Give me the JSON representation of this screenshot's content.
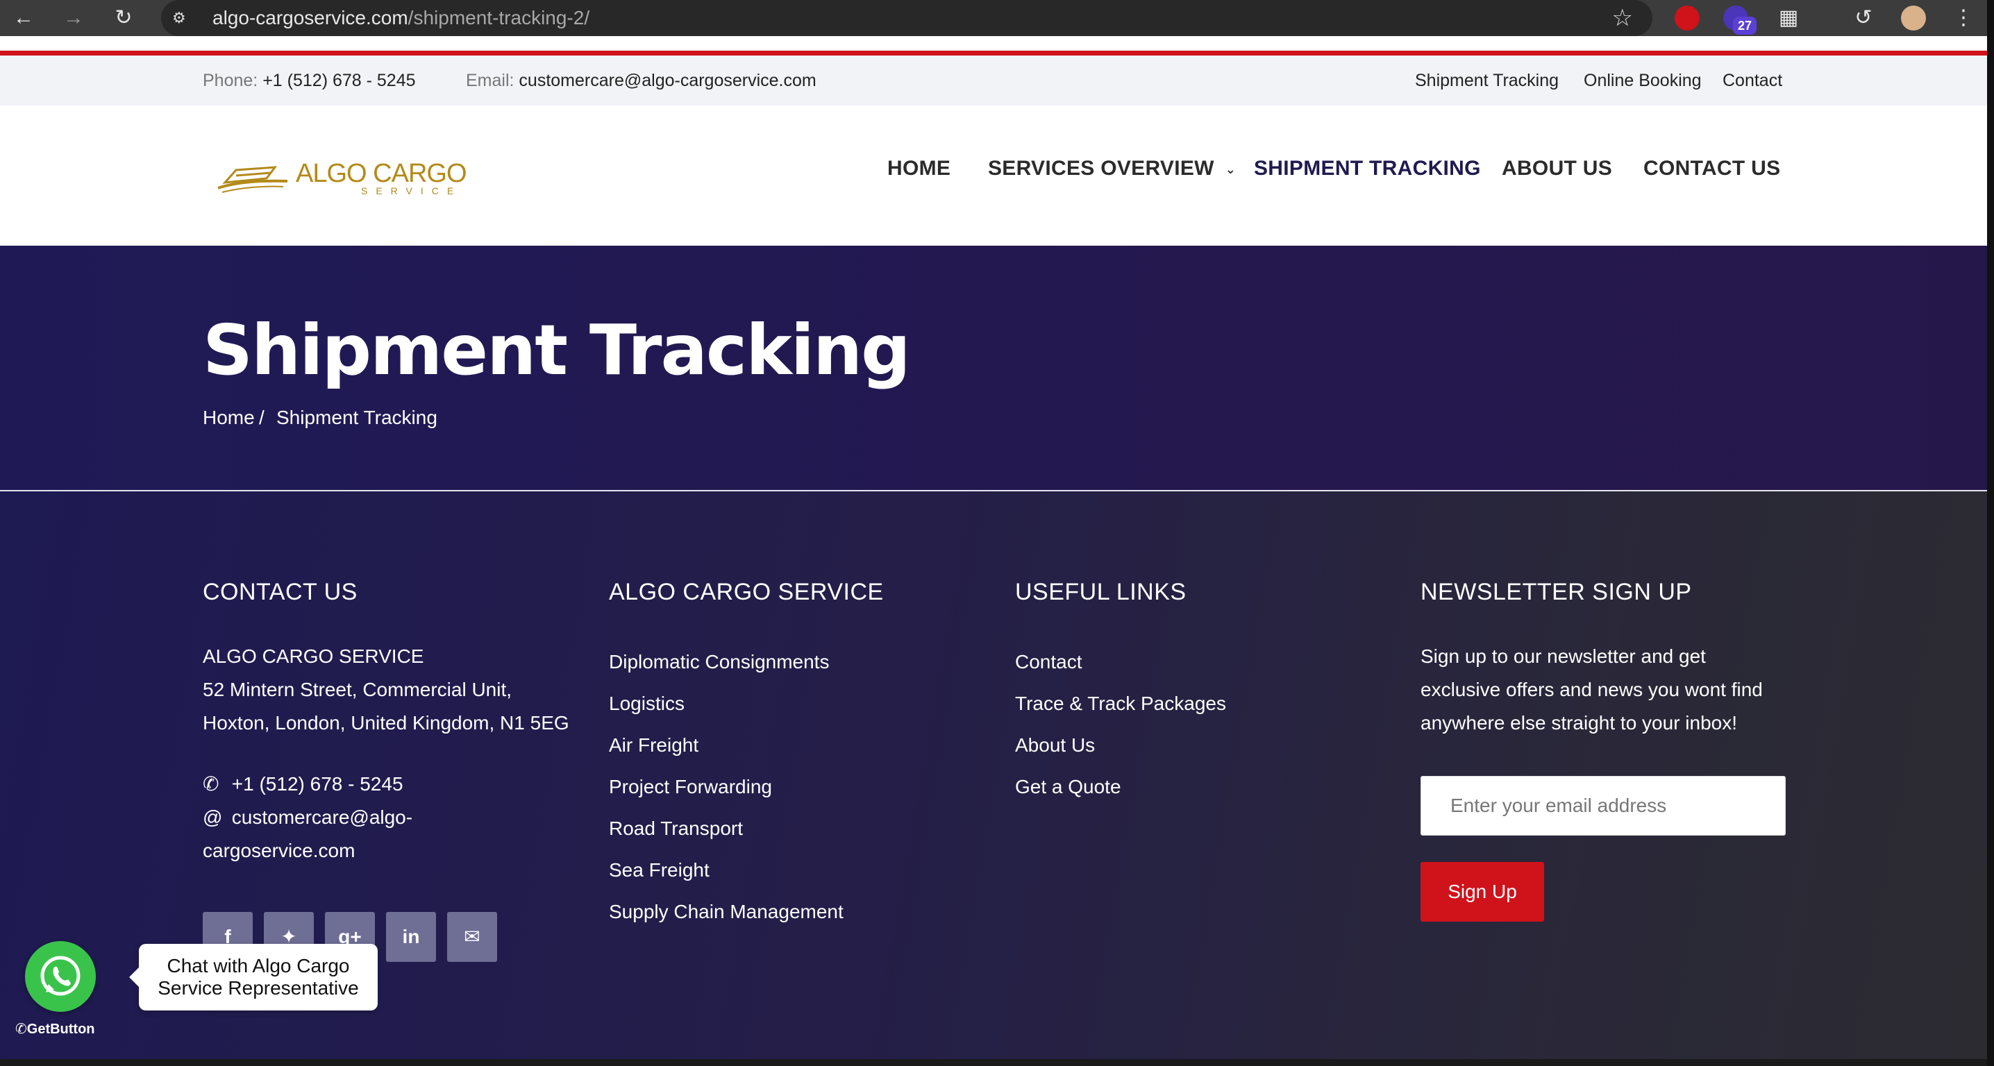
{
  "browser": {
    "url_host": "algo-cargoservice.com",
    "url_path": "/shipment-tracking-2/",
    "extension_badge": "27"
  },
  "topbar": {
    "phone_label": "Phone:",
    "phone": "+1 (512) 678 - 5245",
    "email_label": "Email:",
    "email": "customercare@algo-cargoservice.com",
    "links": [
      "Shipment Tracking",
      "Online Booking",
      "Contact"
    ]
  },
  "header": {
    "logo_name": "ALGO CARGO",
    "logo_sub": "SERVICE",
    "nav": [
      "HOME",
      "SERVICES OVERVIEW",
      "SHIPMENT TRACKING",
      "ABOUT US",
      "CONTACT US"
    ],
    "active_nav": "SHIPMENT TRACKING"
  },
  "hero": {
    "title": "Shipment Tracking",
    "breadcrumb_home": "Home",
    "breadcrumb_sep": "/",
    "breadcrumb_current": "Shipment Tracking"
  },
  "footer": {
    "contact": {
      "heading": "CONTACT US",
      "company": "ALGO CARGO SERVICE",
      "address_line1": "52 Mintern Street, Commercial Unit,",
      "address_line2": "Hoxton, London, United Kingdom, N1 5EG",
      "phone": "+1 (512) 678 - 5245",
      "email_line1": "customercare@algo-",
      "email_line2": "cargoservice.com",
      "social": [
        "facebook-icon",
        "twitter-icon",
        "google-plus-icon",
        "linkedin-icon",
        "mail-icon"
      ]
    },
    "services": {
      "heading": "ALGO CARGO SERVICE",
      "items": [
        "Diplomatic Consignments",
        "Logistics",
        "Air Freight",
        "Project Forwarding",
        "Road Transport",
        "Sea Freight",
        "Supply Chain Management"
      ]
    },
    "useful": {
      "heading": "USEFUL LINKS",
      "items": [
        "Contact",
        "Trace & Track Packages",
        "About Us",
        "Get a Quote"
      ]
    },
    "newsletter": {
      "heading": "NEWSLETTER SIGN UP",
      "text_line1": "Sign up to our newsletter and get",
      "text_line2": "exclusive offers and news you wont find",
      "text_line3": "anywhere else straight to your inbox!",
      "placeholder": "Enter your email address",
      "button": "Sign Up"
    }
  },
  "whatsapp": {
    "tooltip_line1": "Chat with Algo Cargo",
    "tooltip_line2": "Service Representative",
    "brand": "GetButton"
  },
  "colors": {
    "accent_red": "#d0121b",
    "hero_navy": "#1f1a56",
    "logo_gold": "#b38a1a",
    "whatsapp_green": "#3ac34b"
  }
}
